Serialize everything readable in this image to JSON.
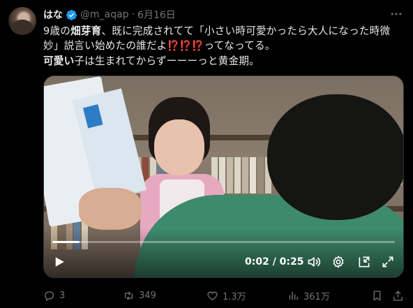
{
  "tweet": {
    "display_name": "はな",
    "handle": "@m_aqap",
    "separator": "·",
    "date": "6月16日",
    "text_line1_pre": "9歳の",
    "text_line1_bold": "畑芽育",
    "text_line1_post": "、既に完成されてて「小さい時可愛かったら大人になった時微",
    "text_line2_pre": "妙」説言い始めたの誰だよ",
    "text_line2_emoji": "⁉️⁉️⁉️",
    "text_line2_post": "ってなってる。",
    "text_line3_bold": "可愛い",
    "text_line3_post": "子は生まれてからずーーーっと黄金期。"
  },
  "video": {
    "time": "0:02 / 0:25",
    "progress": 0.08
  },
  "actions": {
    "replies": "3",
    "retweets": "349",
    "likes": "1.3万",
    "views": "361万"
  },
  "colors": {
    "background": "#000000",
    "text": "#e7e9ea",
    "muted": "#71767b",
    "verified": "#1d9bf0"
  }
}
